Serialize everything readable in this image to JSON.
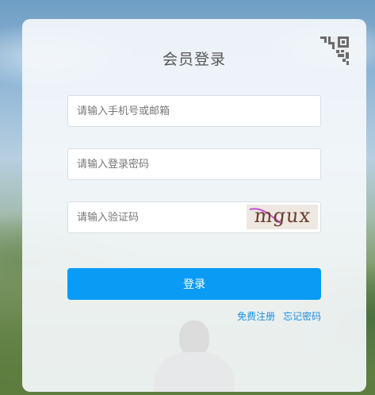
{
  "login": {
    "title": "会员登录",
    "account_placeholder": "请输入手机号或邮箱",
    "password_placeholder": "请输入登录密码",
    "captcha_placeholder": "请输入验证码",
    "captcha_text": "mgux",
    "submit_label": "登录",
    "register_link": "免费注册",
    "forgot_link": "忘记密码"
  },
  "icons": {
    "qr_toggle": "qr-code-icon"
  },
  "colors": {
    "accent": "#0a9cf5",
    "link": "#1a8fe0",
    "card_bg": "#f4f8fb",
    "title": "#555555"
  }
}
